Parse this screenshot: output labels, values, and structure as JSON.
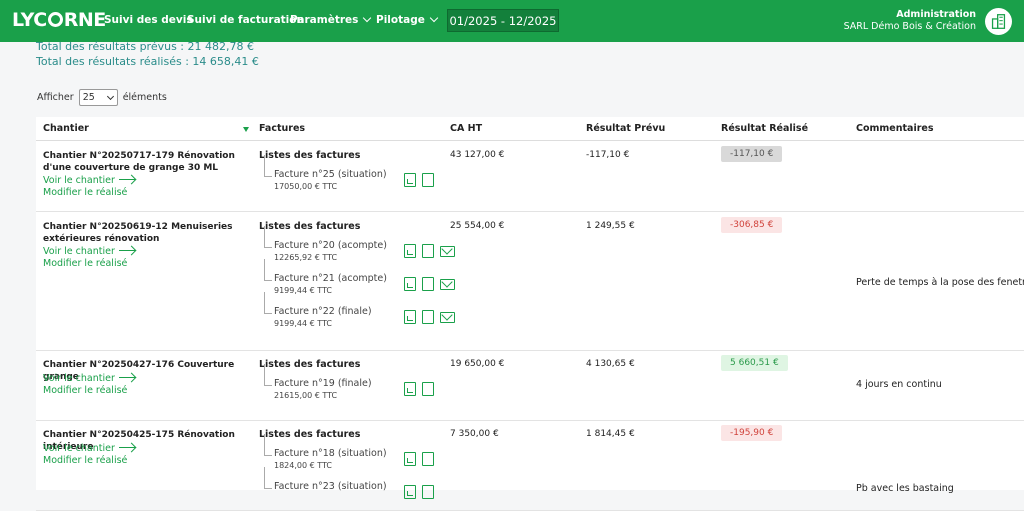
{
  "header": {
    "logo": "LYCORNE",
    "nav": [
      {
        "label": "Suivi des devis"
      },
      {
        "label": "Suivi de facturation"
      },
      {
        "label": "Paramètres"
      },
      {
        "label": "Pilotage"
      }
    ],
    "period": "01/2025 - 12/2025",
    "user_title": "Administration",
    "company": "SARL Démo Bois & Création"
  },
  "summary": {
    "prevus": "Total des résultats prévus : 21 482,78 €",
    "realises": "Total des résultats réalisés : 14 658,41 €"
  },
  "length_menu": {
    "prefix": "Afficher",
    "value": "25",
    "suffix": "éléments"
  },
  "table": {
    "columns": [
      "Chantier",
      "Factures",
      "CA HT",
      "Résultat Prévu",
      "Résultat Réalisé",
      "Commentaires"
    ],
    "voir_label": "Voir le chantier",
    "modifier_label": "Modifier le réalisé",
    "factures_title": "Listes des factures",
    "rows": [
      {
        "chantier": "Chantier N°20250717-179 Rénovation d'une couverture de grange 30 ML",
        "invoices": [
          {
            "name": "Facture n°25 (situation)",
            "amount": "17050,00 € TTC",
            "mail": false
          }
        ],
        "ca": "43 127,00 €",
        "prevu": "-117,10 €",
        "realise": "-117,10 €",
        "realise_status": "neutral",
        "comment": ""
      },
      {
        "chantier": "Chantier N°20250619-12 Menuiseries extérieures rénovation",
        "invoices": [
          {
            "name": "Facture n°20 (acompte)",
            "amount": "12265,92 € TTC",
            "mail": true
          },
          {
            "name": "Facture n°21 (acompte)",
            "amount": "9199,44 € TTC",
            "mail": true
          },
          {
            "name": "Facture n°22 (finale)",
            "amount": "9199,44 € TTC",
            "mail": true
          }
        ],
        "ca": "25 554,00 €",
        "prevu": "1 249,55 €",
        "realise": "-306,85 €",
        "realise_status": "neg",
        "comment": "Perte de temps à la pose des fenetres"
      },
      {
        "chantier": "Chantier N°20250427-176 Couverture grange",
        "invoices": [
          {
            "name": "Facture n°19 (finale)",
            "amount": "21615,00 € TTC",
            "mail": false
          }
        ],
        "ca": "19 650,00 €",
        "prevu": "4 130,65 €",
        "realise": "5 660,51 €",
        "realise_status": "pos",
        "comment": "4 jours en continu"
      },
      {
        "chantier": "Chantier N°20250425-175 Rénovation intérieure",
        "invoices": [
          {
            "name": "Facture n°18 (situation)",
            "amount": "1824,00 € TTC",
            "mail": false
          },
          {
            "name": "Facture n°23 (situation)",
            "amount": "",
            "mail": false
          }
        ],
        "ca": "7 350,00 €",
        "prevu": "1 814,45 €",
        "realise": "-195,90 €",
        "realise_status": "neg",
        "comment": "Pb avec les bastaing"
      }
    ]
  }
}
